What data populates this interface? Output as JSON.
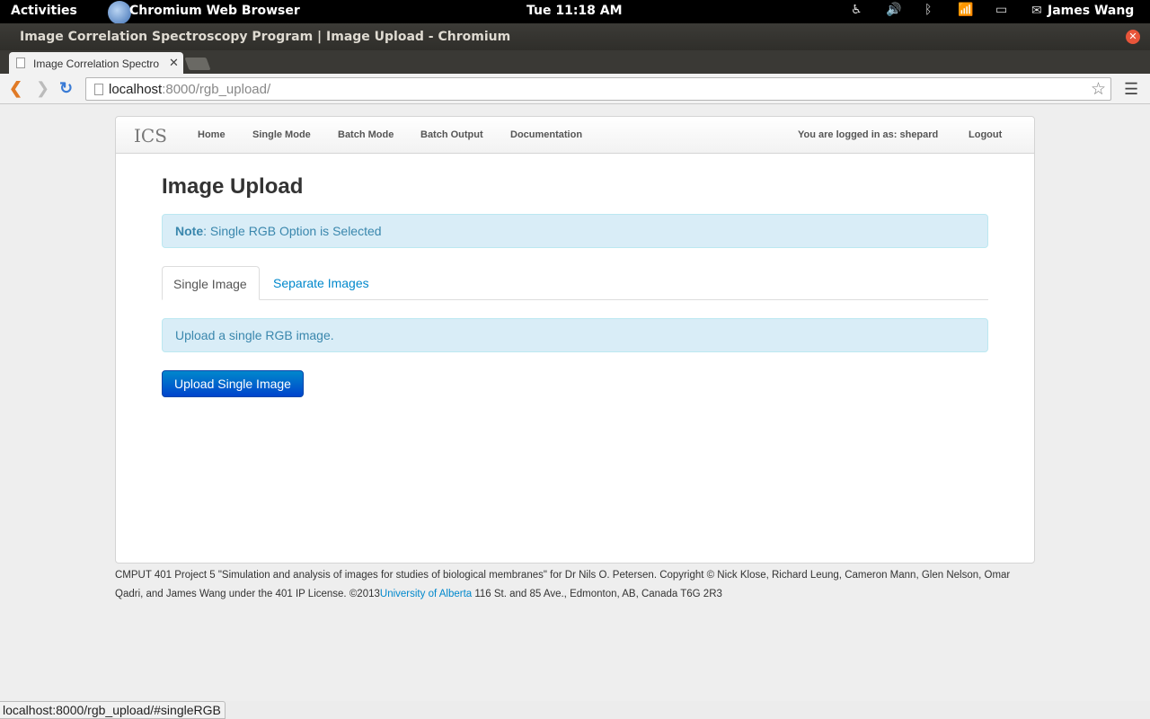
{
  "system_bar": {
    "activities": "Activities",
    "app_name": "Chromium Web Browser",
    "clock": "Tue 11:18 AM",
    "user": "James Wang"
  },
  "window": {
    "title": "Image Correlation Spectroscopy Program | Image Upload - Chromium"
  },
  "browser": {
    "tab_title": "Image Correlation Spectro",
    "url_host": "localhost",
    "url_rest": ":8000/rgb_upload/",
    "status_url": "localhost:8000/rgb_upload/#singleRGB"
  },
  "navbar": {
    "brand": "ICS",
    "links": [
      "Home",
      "Single Mode",
      "Batch Mode",
      "Batch Output",
      "Documentation"
    ],
    "logged_in": "You are logged in as: shepard",
    "logout": "Logout"
  },
  "main": {
    "heading": "Image Upload",
    "note_label": "Note",
    "note_text": ": Single RGB Option is Selected",
    "tabs": [
      "Single Image",
      "Separate Images"
    ],
    "info": "Upload a single RGB image.",
    "upload_button": "Upload Single Image"
  },
  "footer": {
    "text": "CMPUT 401 Project 5 \"Simulation and analysis of images for studies of biological membranes\" for Dr Nils O. Petersen. Copyright © Nick Klose, Richard Leung, Cameron Mann, Glen Nelson, Omar Qadri, and James Wang under the 401 IP License. ©2013",
    "link": "University of Alberta",
    "address": " 116 St. and 85 Ave., Edmonton, AB, Canada T6G 2R3"
  },
  "colors": {
    "link": "#0088cc",
    "alert_bg": "#d9edf7",
    "alert_text": "#3a87ad",
    "primary_button": "#0044cc"
  }
}
